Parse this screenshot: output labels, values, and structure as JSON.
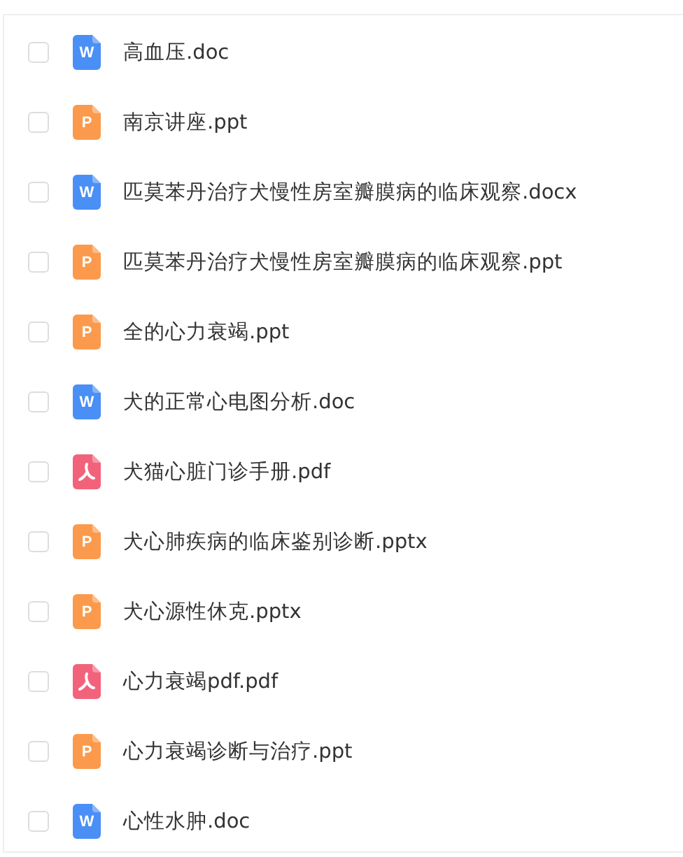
{
  "files": [
    {
      "name": "高血压.doc",
      "kind": "word",
      "badge": "W",
      "checked": false
    },
    {
      "name": "南京讲座.ppt",
      "kind": "slides",
      "badge": "P",
      "checked": false
    },
    {
      "name": "匹莫苯丹治疗犬慢性房室瓣膜病的临床观察.docx",
      "kind": "word",
      "badge": "W",
      "checked": false
    },
    {
      "name": "匹莫苯丹治疗犬慢性房室瓣膜病的临床观察.ppt",
      "kind": "slides",
      "badge": "P",
      "checked": false
    },
    {
      "name": "全的心力衰竭.ppt",
      "kind": "slides",
      "badge": "P",
      "checked": false
    },
    {
      "name": "犬的正常心电图分析.doc",
      "kind": "word",
      "badge": "W",
      "checked": false
    },
    {
      "name": "犬猫心脏门诊手册.pdf",
      "kind": "pdf",
      "checked": false
    },
    {
      "name": "犬心肺疾病的临床鉴别诊断.pptx",
      "kind": "slides",
      "badge": "P",
      "checked": false
    },
    {
      "name": "犬心源性休克.pptx",
      "kind": "slides",
      "badge": "P",
      "checked": false
    },
    {
      "name": "心力衰竭pdf.pdf",
      "kind": "pdf",
      "checked": false
    },
    {
      "name": "心力衰竭诊断与治疗.ppt",
      "kind": "slides",
      "badge": "P",
      "checked": false
    },
    {
      "name": "心性水肿.doc",
      "kind": "word",
      "badge": "W",
      "checked": false
    }
  ]
}
